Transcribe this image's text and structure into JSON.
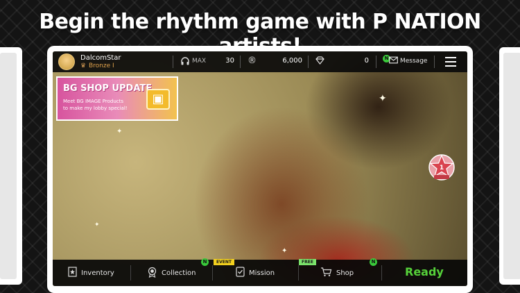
{
  "promo": {
    "headline": "Begin the rhythm game with P NATION artists!"
  },
  "profile": {
    "name": "DalcomStar",
    "rank": "Bronze I"
  },
  "stats": {
    "headphones_label": "MAX",
    "headphones_value": "30",
    "r_icon_glyph": "®",
    "r_value": "6,000",
    "diamond_value": "0",
    "message_label": "Message",
    "new_badge": "N"
  },
  "banner": {
    "title": "BG SHOP UPDATE",
    "line1": "Meet BG IMAGE Products",
    "line2": "to make my lobby special!"
  },
  "bottom_nav": {
    "inventory": "Inventory",
    "collection": "Collection",
    "mission": "Mission",
    "shop": "Shop",
    "event_tag": "EVENT",
    "free_tag": "FREE",
    "new_badge": "N",
    "ready": "Ready"
  },
  "colors": {
    "ready": "#56d23a",
    "new_badge": "#39c93a",
    "event_tag": "#f2d01e",
    "free_tag": "#7be36b",
    "rank": "#e0a24c"
  },
  "icons": [
    "headphones-icon",
    "r-coin-icon",
    "diamond-icon",
    "mail-icon",
    "menu-icon",
    "inventory-icon",
    "collection-icon",
    "mission-icon",
    "cart-icon",
    "star-ranking-icon"
  ]
}
